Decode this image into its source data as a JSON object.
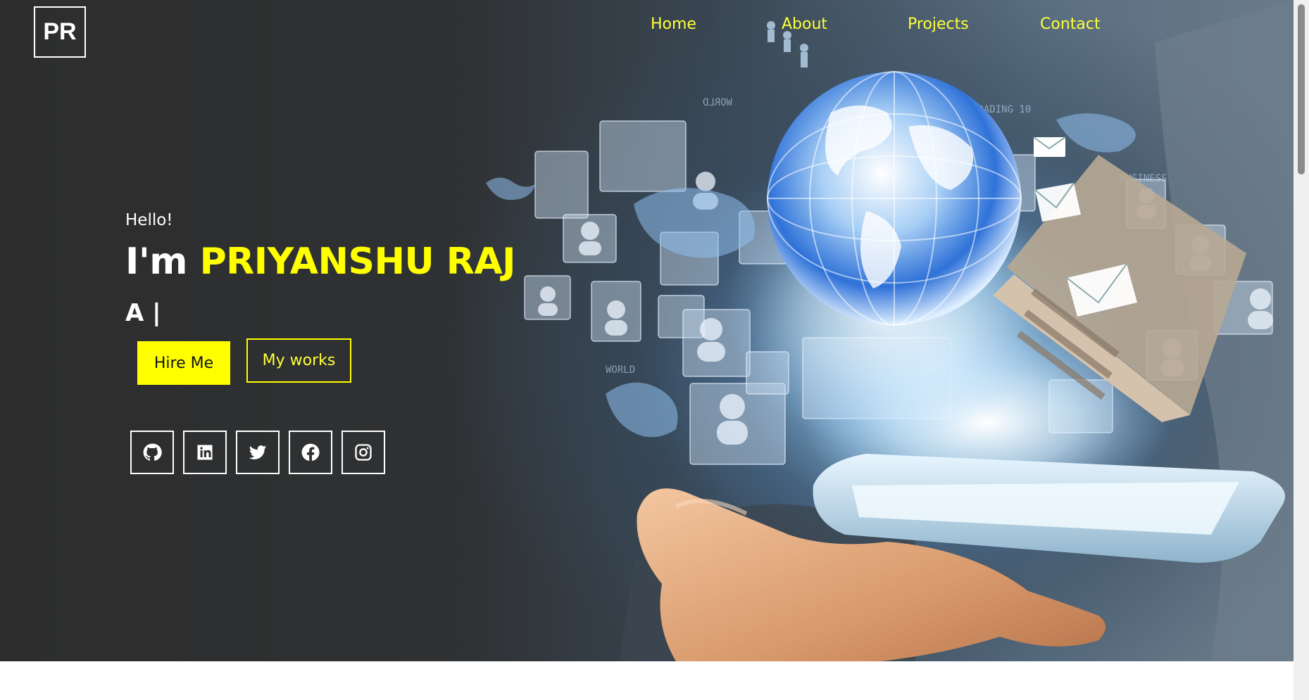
{
  "logo": {
    "text": "PR"
  },
  "nav": {
    "items": [
      {
        "label": "Home"
      },
      {
        "label": "About"
      },
      {
        "label": "Projects"
      },
      {
        "label": "Contact"
      }
    ]
  },
  "hero": {
    "greeting": "Hello!",
    "intro_prefix": "I'm ",
    "name": "PRIYANSHU RAJ",
    "typed_text": "A |",
    "hire_label": "Hire Me",
    "works_label": "My works",
    "accent_color": "#ffff00"
  },
  "social": [
    {
      "icon": "github-icon"
    },
    {
      "icon": "linkedin-icon"
    },
    {
      "icon": "twitter-icon"
    },
    {
      "icon": "facebook-icon"
    },
    {
      "icon": "instagram-icon"
    }
  ],
  "background": {
    "illustration": "hand-holding-tablet-with-globe-and-network-icons"
  }
}
